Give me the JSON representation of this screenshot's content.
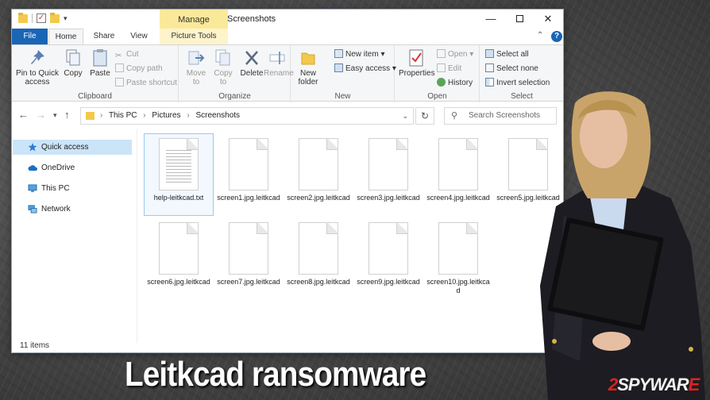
{
  "titlebar": {
    "manage": "Manage",
    "title": "Screenshots"
  },
  "tabs": {
    "file": "File",
    "home": "Home",
    "share": "Share",
    "view": "View",
    "picture_tools": "Picture Tools"
  },
  "ribbon": {
    "clipboard": {
      "label": "Clipboard",
      "pin": "Pin to Quick access",
      "copy": "Copy",
      "paste": "Paste",
      "cut": "Cut",
      "copy_path": "Copy path",
      "paste_shortcut": "Paste shortcut"
    },
    "organize": {
      "label": "Organize",
      "move_to": "Move to",
      "copy_to": "Copy to",
      "delete": "Delete",
      "rename": "Rename"
    },
    "new": {
      "label": "New",
      "new_folder": "New folder",
      "new_item": "New item",
      "easy_access": "Easy access"
    },
    "open": {
      "label": "Open",
      "properties": "Properties",
      "open": "Open",
      "edit": "Edit",
      "history": "History"
    },
    "select": {
      "label": "Select",
      "select_all": "Select all",
      "select_none": "Select none",
      "invert_selection": "Invert selection"
    }
  },
  "address": {
    "crumbs": [
      "This PC",
      "Pictures",
      "Screenshots"
    ],
    "search_placeholder": "Search Screenshots"
  },
  "sidebar": [
    {
      "label": "Quick access",
      "icon": "star-icon",
      "selected": true
    },
    {
      "label": "OneDrive",
      "icon": "cloud-icon"
    },
    {
      "label": "This PC",
      "icon": "monitor-icon"
    },
    {
      "label": "Network",
      "icon": "network-icon"
    }
  ],
  "files": [
    {
      "name": "help-leitkcad.txt",
      "type": "txt"
    },
    {
      "name": "screen1.jpg.leitkcad"
    },
    {
      "name": "screen2.jpg.leitkcad"
    },
    {
      "name": "screen3.jpg.leitkcad"
    },
    {
      "name": "screen4.jpg.leitkcad"
    },
    {
      "name": "screen5.jpg.leitkcad"
    },
    {
      "name": "screen6.jpg.leitkcad"
    },
    {
      "name": "screen7.jpg.leitkcad"
    },
    {
      "name": "screen8.jpg.leitkcad"
    },
    {
      "name": "screen9.jpg.leitkcad"
    },
    {
      "name": "screen10.jpg.leitkcad"
    }
  ],
  "status": {
    "items": "11 items"
  },
  "caption": "Leitkcad ransomware",
  "brand": {
    "prefix": "2",
    "rest": "SPYWAR",
    "suffix": "E"
  },
  "colors": {
    "accent": "#1a65b5",
    "manage_tab": "#fbe99a",
    "selected": "#cce4f7"
  }
}
